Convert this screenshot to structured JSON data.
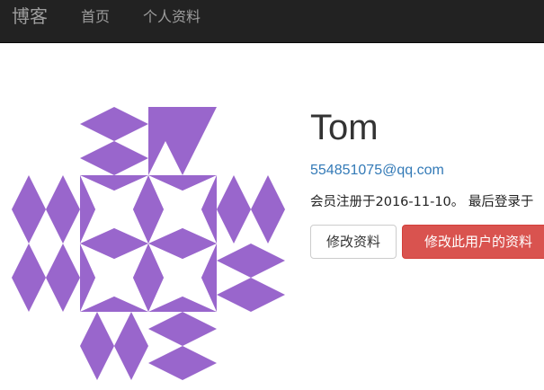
{
  "navbar": {
    "brand": "博客",
    "links": [
      "首页",
      "个人资料"
    ]
  },
  "profile": {
    "avatar_icon": "identicon-avatar",
    "avatar_color": "#9966cc",
    "username": "Tom",
    "email": "554851075@qq.com",
    "member_info": "会员注册于2016-11-10。 最后登录于",
    "buttons": {
      "edit_profile": "修改资料",
      "edit_user_profile": "修改此用户的资料"
    }
  }
}
